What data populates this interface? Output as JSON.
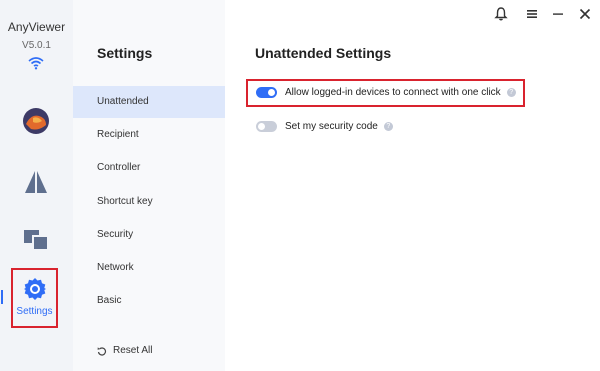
{
  "app": {
    "name": "AnyViewer",
    "version": "V5.0.1"
  },
  "rail": {
    "items": [
      {
        "name": "avatar"
      },
      {
        "name": "connect"
      },
      {
        "name": "devices"
      },
      {
        "name": "settings",
        "label": "Settings",
        "active": true
      }
    ]
  },
  "window_controls": {
    "notify": "bell-icon",
    "menu": "menu-icon",
    "minimize": "minimize-icon",
    "close": "close-icon"
  },
  "nav": {
    "title": "Settings",
    "items": [
      {
        "label": "Unattended",
        "active": true
      },
      {
        "label": "Recipient"
      },
      {
        "label": "Controller"
      },
      {
        "label": "Shortcut key"
      },
      {
        "label": "Security"
      },
      {
        "label": "Network"
      },
      {
        "label": "Basic"
      }
    ],
    "reset_label": "Reset All"
  },
  "main": {
    "title": "Unattended Settings",
    "options": [
      {
        "label": "Allow logged-in devices to connect with one click",
        "enabled": true
      },
      {
        "label": "Set my security code",
        "enabled": false
      }
    ]
  },
  "colors": {
    "accent": "#2f6df6",
    "highlight": "#d9232e",
    "rail_bg": "#f2f4f8"
  }
}
